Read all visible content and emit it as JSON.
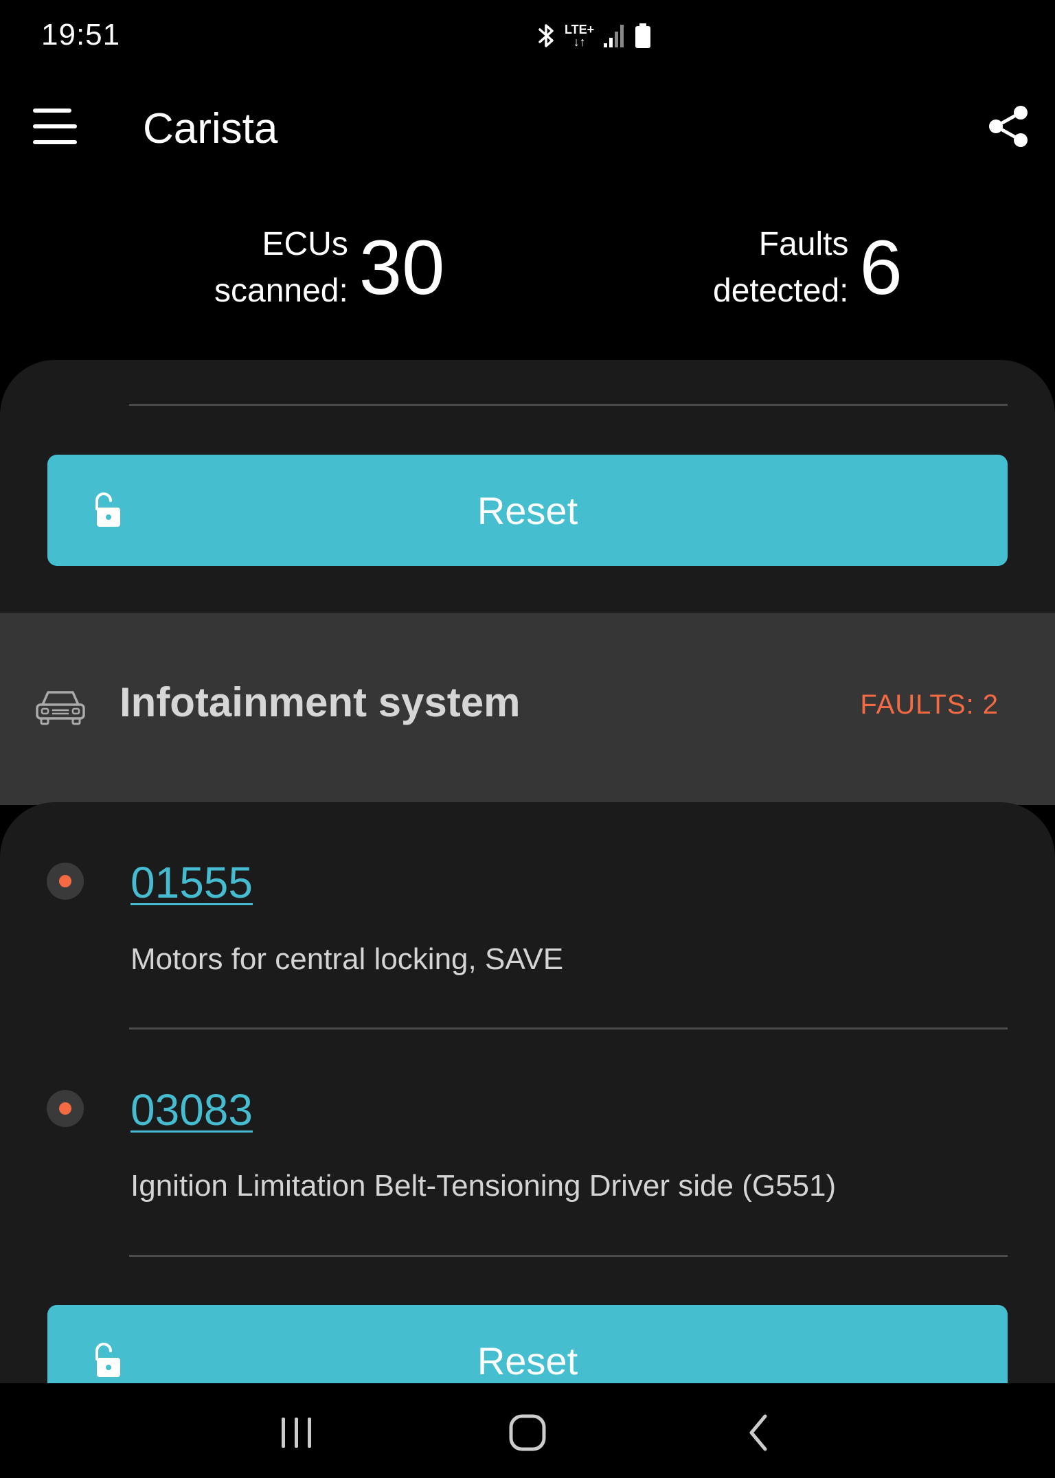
{
  "status_bar": {
    "time": "19:51",
    "network_label_top": "LTE+",
    "icons": [
      "bluetooth-icon",
      "lte-data-icon",
      "signal-icon",
      "battery-icon"
    ]
  },
  "app_bar": {
    "title": "Carista",
    "menu_icon": "hamburger-menu-icon",
    "share_icon": "share-icon"
  },
  "stats": {
    "ecus_label_line1": "ECUs",
    "ecus_label_line2": "scanned:",
    "ecus_value": "30",
    "faults_label_line1": "Faults",
    "faults_label_line2": "detected:",
    "faults_value": "6"
  },
  "card1": {
    "reset_label": "Reset",
    "reset_icon": "unlock-icon"
  },
  "section": {
    "icon": "car-icon",
    "title": "Infotainment system",
    "faults_badge": "FAULTS: 2"
  },
  "faults": [
    {
      "code": "01555",
      "description": "Motors for central locking, SAVE"
    },
    {
      "code": "03083",
      "description": "Ignition Limitation Belt-Tensioning Driver side (G551)"
    }
  ],
  "card2": {
    "reset_label": "Reset",
    "reset_icon": "unlock-icon"
  },
  "nav_bar": {
    "icons": [
      "recent-apps-icon",
      "home-icon",
      "back-icon"
    ]
  },
  "colors": {
    "accent": "#45bfcf",
    "fault": "#f36a43",
    "card": "#1b1b1b",
    "section_header": "#363636",
    "background": "#000000"
  }
}
